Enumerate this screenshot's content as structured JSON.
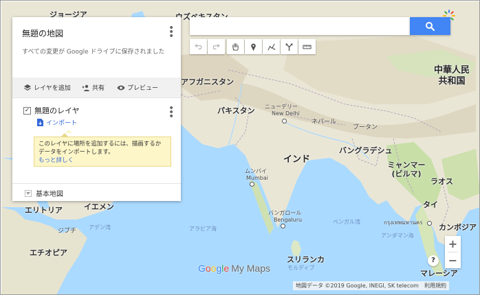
{
  "panel": {
    "title": "無題の地図",
    "save_status": "すべての変更が Google ドライブに保存されました",
    "toolbar": {
      "add_layer": "レイヤを追加",
      "share": "共有",
      "preview": "プレビュー"
    },
    "layer": {
      "name": "無題のレイヤ",
      "import": "インポート",
      "tooltip_text": "このレイヤに場所を追加するには、描画するかデータをインポートします。",
      "learn_more": "もっと詳しく"
    },
    "basemap_label": "基本地図"
  },
  "search": {
    "value": "",
    "placeholder": ""
  },
  "map": {
    "labels": {
      "georgia": "ジョージア",
      "uzbekistan": "ウズベキスタン",
      "afghanistan": "アフガニスタン",
      "pakistan": "パキスタン",
      "china": "中華人民共和国",
      "new_delhi": "ニューデリー",
      "new_delhi_en": "New Delhi",
      "nepal": "ネパール",
      "bhutan": "ブータン",
      "india": "インド",
      "bangladesh": "バングラデシュ",
      "myanmar": "ミャンマー (ビルマ)",
      "laos": "ラオス",
      "mumbai": "ムンバイ",
      "mumbai_en": "Mumbai",
      "thailand": "タイ",
      "bangkok": "กรุงเทพมหานคร",
      "cambodia": "カンボジア",
      "eritrea": "エリトリア",
      "yemen": "イエメン",
      "djibouti": "ジブチ",
      "ethiopia": "エチオピア",
      "gulf_aden": "アデン湾",
      "arabian_sea": "アラビア海",
      "bengaluru": "バンガロール",
      "bengaluru_en": "Bengaluru",
      "bay_of_bengal": "ベンガル湾",
      "andaman_sea": "アンダマン海",
      "sri_lanka": "スリランカ",
      "maldives": "モルディブ",
      "malaysia": "マレーシア"
    },
    "attribution": "地図データ ©2019 Google, INEGI, SK telecom",
    "terms": "利用規約",
    "brand_google": "Google",
    "brand_my_maps": "My Maps",
    "colors": {
      "water": "#aadaff",
      "land": "#eae6d6",
      "mountain": "#d9d2bd",
      "forest": "#c8dfa8",
      "accent": "#4285f4",
      "link": "#3367d6",
      "tooltip_bg": "#fdf6c8"
    }
  }
}
